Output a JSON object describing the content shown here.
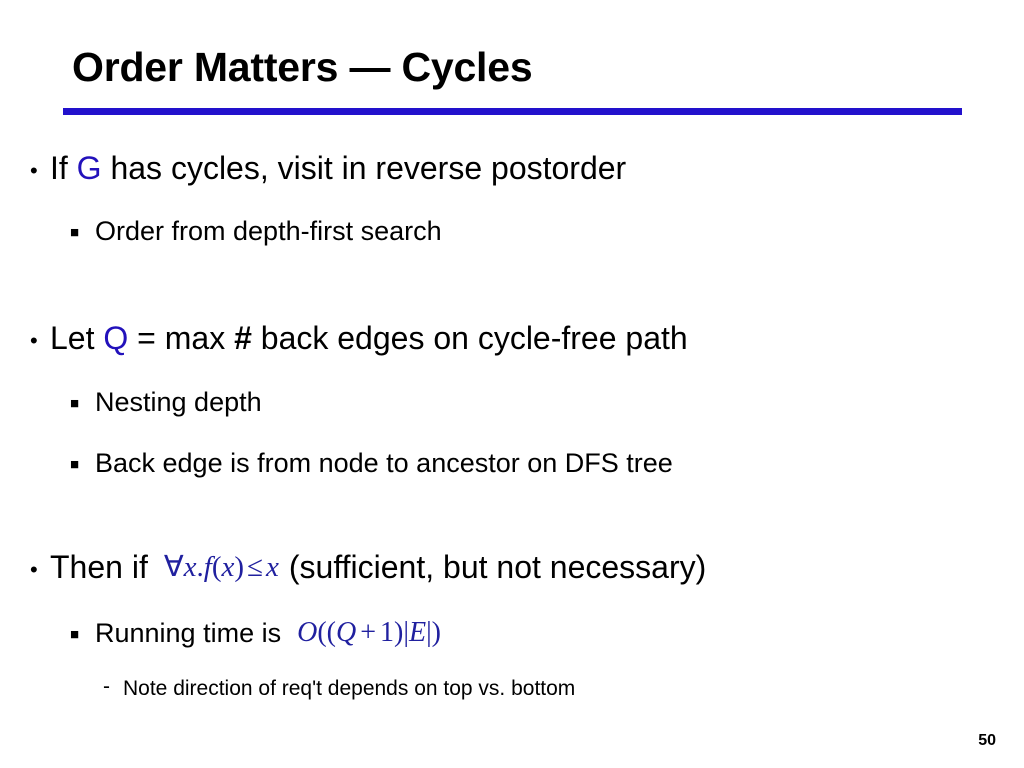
{
  "slide": {
    "title": "Order Matters — Cycles",
    "rule_color": "#2211cc",
    "accent_color": "#2211bb",
    "math_color": "#20209f",
    "page_number": "50"
  },
  "bullets": {
    "b1": {
      "marker": "•",
      "pre": "If ",
      "symbol": "G",
      "post": " has cycles, visit in reverse postorder"
    },
    "b1s1": {
      "marker": "■",
      "text": "Order from depth-first search"
    },
    "b2": {
      "marker": "•",
      "pre": "Let ",
      "symbol": "Q",
      "mid": " = max ",
      "hash": "#",
      "post": " back edges on cycle-free path"
    },
    "b2s1": {
      "marker": "■",
      "text": "Nesting depth"
    },
    "b2s2": {
      "marker": "■",
      "text": "Back edge is from node to ancestor on DFS tree"
    },
    "b3": {
      "marker": "•",
      "pre": "Then if",
      "post": "(sufficient, but not necessary)",
      "formula": {
        "forall": "∀",
        "var1": "x",
        "dot": ".",
        "fn": "f",
        "open": "(",
        "var2": "x",
        "close": ")",
        "rel": "≤",
        "var3": "x",
        "plain": "∀x.f(x) ≤ x"
      }
    },
    "b3s1": {
      "marker": "■",
      "text": "Running time is",
      "formula": {
        "big_o": "O",
        "open1": "(",
        "open2": "(",
        "q": "Q",
        "plus": "+",
        "one": "1",
        "close1": ")",
        "bar1": "|",
        "e": "E",
        "bar2": "|",
        "close2": ")",
        "plain": "O((Q + 1)|E|)"
      }
    },
    "b3s1s1": {
      "marker": "-",
      "text": "Note direction of req't depends on top vs. bottom"
    }
  }
}
